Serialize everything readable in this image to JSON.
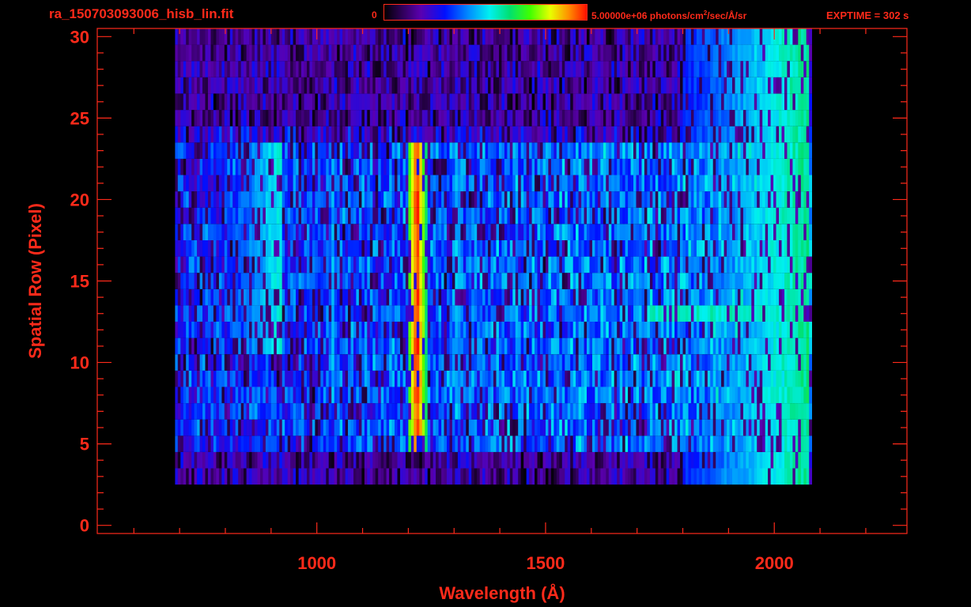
{
  "header": {
    "filename": "ra_150703093006_hisb_lin.fit",
    "colorbar_min": "0",
    "colorbar_max_prefix": "5.00000e+06 photons/cm",
    "colorbar_max_exp": "2",
    "colorbar_max_suffix": "/sec/Å/sr",
    "exptime": "EXPTIME = 302 s"
  },
  "chart_data": {
    "type": "heatmap",
    "title": "",
    "xlabel": "Wavelength (Å)",
    "ylabel": "Spatial Row (Pixel)",
    "xlim": [
      520,
      2290
    ],
    "ylim": [
      -0.5,
      30.5
    ],
    "xticks_major": [
      1000,
      1500,
      2000
    ],
    "xticks_minor": [
      600,
      700,
      800,
      900,
      1100,
      1200,
      1300,
      1400,
      1600,
      1700,
      1800,
      1900,
      2100,
      2200
    ],
    "yticks_major": [
      0,
      5,
      10,
      15,
      20,
      25,
      30
    ],
    "yticks_minor_step": 1,
    "grid": false,
    "colorbar": {
      "min": 0,
      "max": 5000000,
      "units": "photons/cm^2/sec/Å/sr"
    },
    "colors": {
      "axis": "#ff2a1a",
      "background": "#000000"
    },
    "data_extent": {
      "x_min": 690,
      "x_max": 2080,
      "y_min": 3,
      "y_max": 30
    },
    "features": [
      {
        "name": "bright emission line",
        "x": 1216,
        "y_range": [
          5,
          23
        ],
        "level": 1.0
      },
      {
        "name": "emission line",
        "x": 1304,
        "y_range": [
          7,
          23
        ],
        "level": 0.5
      },
      {
        "name": "emission line",
        "x": 1032,
        "y_range": [
          8,
          23
        ],
        "level": 0.45
      },
      {
        "name": "diffuse arc feature",
        "x_range": [
          800,
          920
        ],
        "y_range": [
          11,
          23
        ],
        "level": 0.45
      },
      {
        "name": "continuum row",
        "x_range": [
          1720,
          2070
        ],
        "y": 13,
        "level": 0.55
      },
      {
        "name": "long-wavelength continuum",
        "x_range": [
          1800,
          2070
        ],
        "y_range": [
          3,
          30
        ],
        "level": 0.5
      }
    ]
  }
}
